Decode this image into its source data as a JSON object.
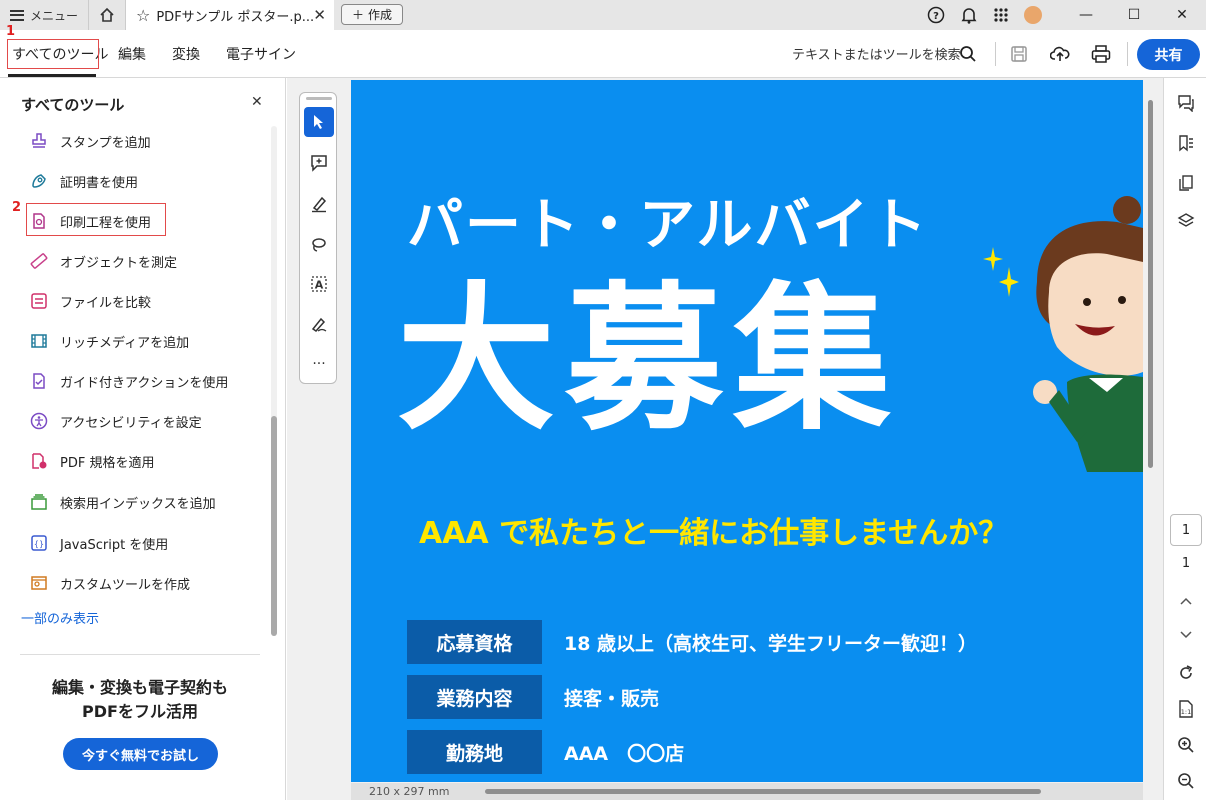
{
  "titlebar": {
    "menu_label": "メニュー",
    "doc_tab_title": "PDFサンプル ポスター.p...",
    "create_label": "作成"
  },
  "toolbar": {
    "tabs": [
      "すべてのツール",
      "編集",
      "変換",
      "電子サイン"
    ],
    "search_placeholder": "テキストまたはツールを検索",
    "share_label": "共有"
  },
  "annotations": {
    "step1": "1",
    "step2": "2"
  },
  "panel": {
    "title": "すべてのツール",
    "items": [
      {
        "label": "スタンプを追加",
        "icon": "stamp-icon"
      },
      {
        "label": "証明書を使用",
        "icon": "certificate-icon"
      },
      {
        "label": "印刷工程を使用",
        "icon": "print-production-icon"
      },
      {
        "label": "オブジェクトを測定",
        "icon": "ruler-icon"
      },
      {
        "label": "ファイルを比較",
        "icon": "compare-icon"
      },
      {
        "label": "リッチメディアを追加",
        "icon": "film-icon"
      },
      {
        "label": "ガイド付きアクションを使用",
        "icon": "guided-action-icon"
      },
      {
        "label": "アクセシビリティを設定",
        "icon": "accessibility-icon"
      },
      {
        "label": "PDF 規格を適用",
        "icon": "pdf-standard-icon"
      },
      {
        "label": "検索用インデックスを追加",
        "icon": "index-icon"
      },
      {
        "label": "JavaScript を使用",
        "icon": "javascript-icon"
      },
      {
        "label": "カスタムツールを作成",
        "icon": "custom-tool-icon"
      }
    ],
    "show_less": "一部のみ表示",
    "promo_line1": "編集・変換も電子契約も",
    "promo_line2": "PDFをフル活用",
    "trial_button": "今すぐ無料でお試し"
  },
  "document": {
    "heading": "パート・アルバイト",
    "big_title": "大募集",
    "subtitle": "AAA で私たちと一緒にお仕事しませんか？",
    "rows": [
      {
        "label": "応募資格",
        "value": "18 歳以上（高校生可、学生フリーター歓迎！）"
      },
      {
        "label": "業務内容",
        "value": "接客・販売"
      },
      {
        "label": "勤務地",
        "value": "AAA　〇〇店"
      }
    ],
    "page_size": "210 x 297 mm"
  },
  "pagination": {
    "current": "1",
    "total": "1"
  },
  "colors": {
    "accent": "#1565d8",
    "poster_bg": "#0a8ef0",
    "poster_label_bg": "#0b5ca8",
    "poster_subtitle": "#ffe600",
    "annotation_red": "#e02020"
  }
}
